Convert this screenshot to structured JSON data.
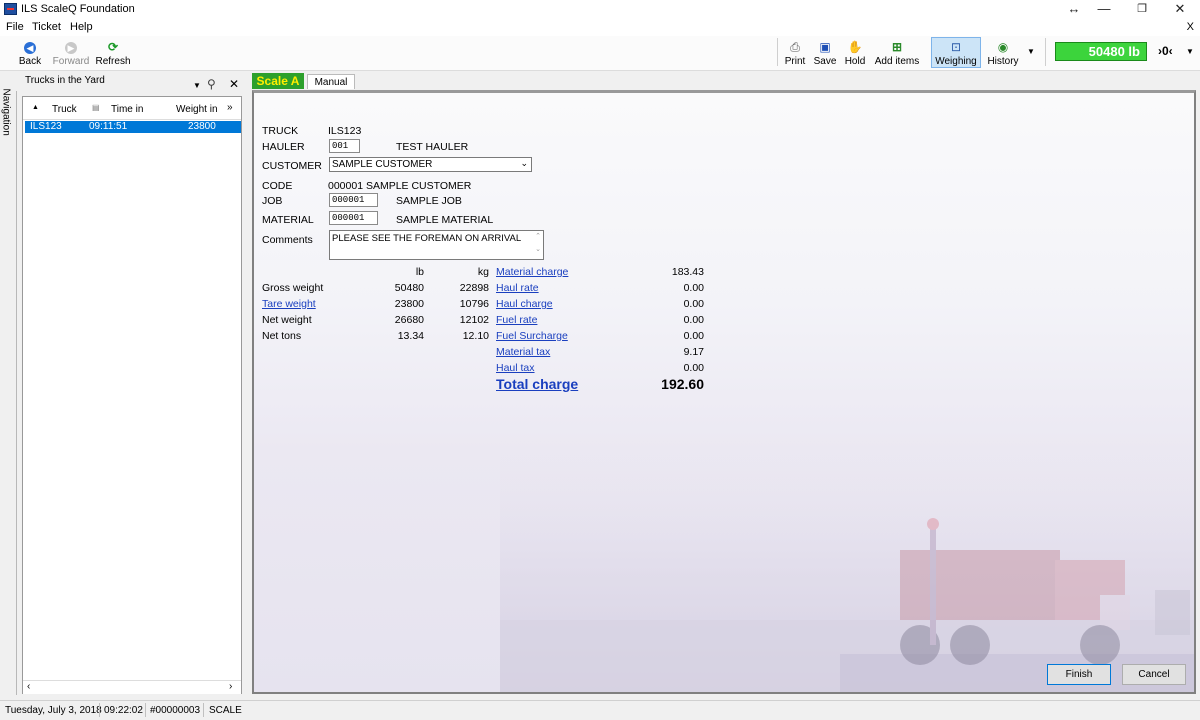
{
  "window": {
    "title": "ILS ScaleQ Foundation"
  },
  "menu": {
    "items": [
      "File",
      "Ticket",
      "Help"
    ],
    "close_mark": "X"
  },
  "nav_toolbar": {
    "back": "Back",
    "forward": "Forward",
    "refresh": "Refresh"
  },
  "toolbar": {
    "print": "Print",
    "save": "Save",
    "hold": "Hold",
    "add_items": "Add items",
    "weighing": "Weighing",
    "history": "History"
  },
  "scale_display": {
    "value": "50480 lb",
    "zero": "›0‹"
  },
  "navigation_tab": "Navigation",
  "trucks_panel": {
    "title": "Trucks in the Yard",
    "columns": [
      "Truck",
      "Time in",
      "Weight in"
    ],
    "rows": [
      {
        "truck": "ILS123",
        "time_in": "09:11:51",
        "weight_in": "23800"
      }
    ]
  },
  "tabs": {
    "scale": "Scale A",
    "manual": "Manual"
  },
  "ticket": {
    "truck_label": "TRUCK",
    "truck_value": "ILS123",
    "hauler_label": "HAULER",
    "hauler_code": "001",
    "hauler_name": "TEST HAULER",
    "customer_label": "CUSTOMER",
    "customer_value": "SAMPLE CUSTOMER",
    "code_label": "CODE",
    "code_value": "000001 SAMPLE CUSTOMER",
    "job_label": "JOB",
    "job_code": "000001",
    "job_name": "SAMPLE JOB",
    "material_label": "MATERIAL",
    "material_code": "000001",
    "material_name": "SAMPLE MATERIAL",
    "comments_label": "Comments",
    "comments_value": "PLEASE SEE THE FOREMAN ON ARRIVAL"
  },
  "weights": {
    "unit_lb": "lb",
    "unit_kg": "kg",
    "rows": [
      {
        "label": "Gross weight",
        "lb": "50480",
        "kg": "22898"
      },
      {
        "label": "Tare weight ",
        "lb": "23800",
        "kg": "10796"
      },
      {
        "label": "Net weight",
        "lb": "26680",
        "kg": "12102"
      },
      {
        "label": "Net tons",
        "lb": "13.34",
        "kg": "12.10"
      }
    ]
  },
  "charges": {
    "rows": [
      {
        "label": "Material charge",
        "value": "183.43"
      },
      {
        "label": "Haul rate ",
        "value": "0.00"
      },
      {
        "label": "Haul charge",
        "value": "0.00"
      },
      {
        "label": "Fuel rate ",
        "value": "0.00"
      },
      {
        "label": "Fuel Surcharge",
        "value": "0.00"
      },
      {
        "label": "Material tax",
        "value": "9.17"
      },
      {
        "label": "Haul tax",
        "value": "0.00"
      }
    ],
    "total_label": "Total charge",
    "total_value": "192.60"
  },
  "buttons": {
    "finish": "Finish",
    "cancel": "Cancel"
  },
  "status": {
    "date": "Tuesday, July 3, 2018",
    "time": "09:22:02",
    "ticket": "#00000003",
    "mode": "SCALE"
  },
  "colors": {
    "accent": "#0078d7",
    "scale_green": "#3cd43c",
    "link": "#1a3fbf"
  }
}
